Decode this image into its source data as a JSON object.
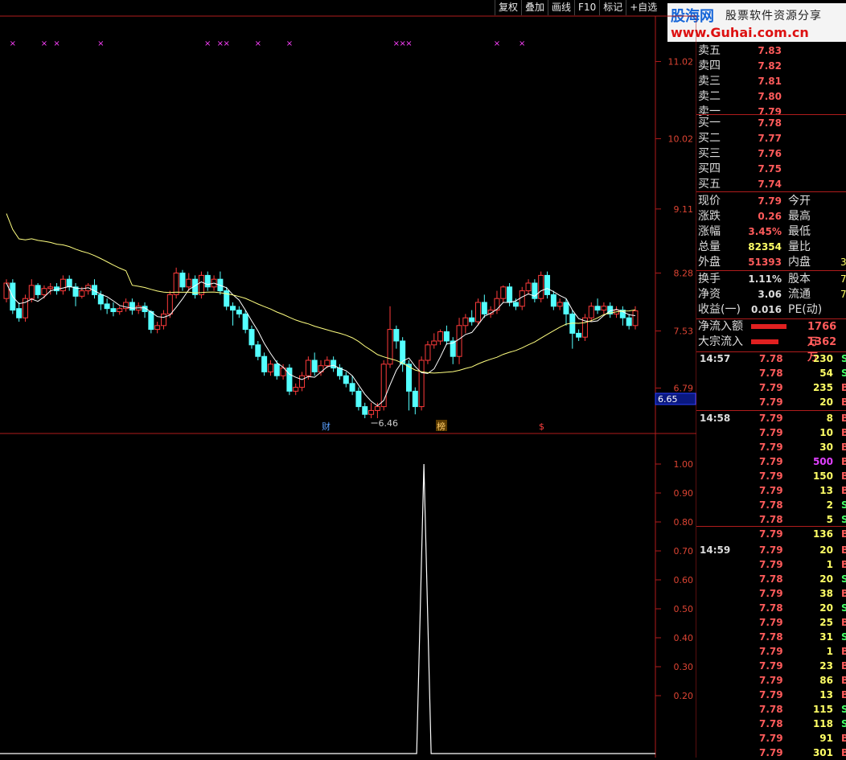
{
  "toolbar": {
    "items": [
      "复权",
      "叠加",
      "画线",
      "F10",
      "标记",
      "+自选"
    ]
  },
  "logo": {
    "brand": "股海网",
    "slogan": "股票软件资源分享",
    "url": "www.Guhai.com.cn"
  },
  "price_axis": {
    "labels": [
      "11.02",
      "10.02",
      "9.11",
      "8.28",
      "7.53",
      "6.79"
    ],
    "current": "6.65"
  },
  "indicator_axis": {
    "labels": [
      "1.00",
      "0.90",
      "0.80",
      "0.70",
      "0.60",
      "0.50",
      "0.40",
      "0.30",
      "0.20"
    ]
  },
  "chart_markers": {
    "low_label": "6.46",
    "cai": "财",
    "bang": "榜",
    "dollar": "$"
  },
  "colors": {
    "up": "#ff3b3b",
    "down": "#54ffff",
    "ma_fast": "#ffffff",
    "ma_slow": "#ffff80",
    "frame": "#b01c1c",
    "marker": "#ff40ff"
  },
  "order_book": {
    "sells": [
      {
        "label": "卖五",
        "price": "7.83"
      },
      {
        "label": "卖四",
        "price": "7.82"
      },
      {
        "label": "卖三",
        "price": "7.81"
      },
      {
        "label": "卖二",
        "price": "7.80"
      },
      {
        "label": "卖一",
        "price": "7.79"
      }
    ],
    "buys": [
      {
        "label": "买一",
        "price": "7.78"
      },
      {
        "label": "买二",
        "price": "7.77"
      },
      {
        "label": "买三",
        "price": "7.76"
      },
      {
        "label": "买四",
        "price": "7.75"
      },
      {
        "label": "买五",
        "price": "7.74"
      }
    ]
  },
  "quote": [
    {
      "k": "现价",
      "v": "7.79",
      "vc": "#ff5b5b",
      "k2": "今开",
      "v2": ""
    },
    {
      "k": "涨跌",
      "v": "0.26",
      "vc": "#ff5b5b",
      "k2": "最高",
      "v2": ""
    },
    {
      "k": "涨幅",
      "v": "3.45%",
      "vc": "#ff5b5b",
      "k2": "最低",
      "v2": ""
    },
    {
      "k": "总量",
      "v": "82354",
      "vc": "#ffff66",
      "k2": "量比",
      "v2": ""
    },
    {
      "k": "外盘",
      "v": "51393",
      "vc": "#ff5b5b",
      "k2": "内盘",
      "v2": "3"
    }
  ],
  "quote2": [
    {
      "k": "换手",
      "v": "1.11%",
      "vc": "#ddd",
      "k2": "股本",
      "v2": "7"
    },
    {
      "k": "净资",
      "v": "3.06",
      "vc": "#ddd",
      "k2": "流通",
      "v2": "7"
    },
    {
      "k": "收益(一)",
      "v": "0.016",
      "vc": "#ddd",
      "k2": "PE(动)",
      "v2": ""
    }
  ],
  "flows": [
    {
      "k": "净流入额",
      "v": "1766万",
      "bar": 1.0
    },
    {
      "k": "大宗流入",
      "v": "1362万",
      "bar": 0.77
    }
  ],
  "ticks": [
    {
      "t": "14:57",
      "p": "7.78",
      "v": "230",
      "f": "S"
    },
    {
      "t": "",
      "p": "7.78",
      "v": "54",
      "f": "S"
    },
    {
      "t": "",
      "p": "7.79",
      "v": "235",
      "f": "B"
    },
    {
      "t": "",
      "p": "7.79",
      "v": "20",
      "f": "B"
    },
    {
      "t": "14:58",
      "p": "7.79",
      "v": "8",
      "f": "B"
    },
    {
      "t": "",
      "p": "7.79",
      "v": "10",
      "f": "B"
    },
    {
      "t": "",
      "p": "7.79",
      "v": "30",
      "f": "B"
    },
    {
      "t": "",
      "p": "7.79",
      "v": "500",
      "f": "B"
    },
    {
      "t": "",
      "p": "7.79",
      "v": "150",
      "f": "B"
    },
    {
      "t": "",
      "p": "7.79",
      "v": "13",
      "f": "B"
    },
    {
      "t": "",
      "p": "7.78",
      "v": "2",
      "f": "S"
    },
    {
      "t": "",
      "p": "7.78",
      "v": "5",
      "f": "S"
    },
    {
      "t": "",
      "p": "7.79",
      "v": "136",
      "f": "B"
    },
    {
      "t": "14:59",
      "p": "7.79",
      "v": "20",
      "f": "B"
    },
    {
      "t": "",
      "p": "7.79",
      "v": "1",
      "f": "B"
    },
    {
      "t": "",
      "p": "7.78",
      "v": "20",
      "f": "S"
    },
    {
      "t": "",
      "p": "7.79",
      "v": "38",
      "f": "B"
    },
    {
      "t": "",
      "p": "7.78",
      "v": "20",
      "f": "S"
    },
    {
      "t": "",
      "p": "7.79",
      "v": "25",
      "f": "B"
    },
    {
      "t": "",
      "p": "7.78",
      "v": "31",
      "f": "S"
    },
    {
      "t": "",
      "p": "7.79",
      "v": "1",
      "f": "B"
    },
    {
      "t": "",
      "p": "7.79",
      "v": "23",
      "f": "B"
    },
    {
      "t": "",
      "p": "7.79",
      "v": "86",
      "f": "B"
    },
    {
      "t": "",
      "p": "7.79",
      "v": "13",
      "f": "B"
    },
    {
      "t": "",
      "p": "7.78",
      "v": "115",
      "f": "S"
    },
    {
      "t": "",
      "p": "7.78",
      "v": "118",
      "f": "S"
    },
    {
      "t": "",
      "p": "7.79",
      "v": "91",
      "f": "B"
    },
    {
      "t": "",
      "p": "7.79",
      "v": "301",
      "f": "B"
    }
  ],
  "chart_data": {
    "type": "candlestick",
    "y_range": [
      6.4,
      11.4
    ],
    "candles": [
      [
        7.95,
        8.15,
        7.9,
        8.2
      ],
      [
        8.15,
        7.8,
        7.75,
        8.2
      ],
      [
        7.82,
        7.7,
        7.65,
        7.9
      ],
      [
        7.7,
        7.95,
        7.65,
        8.0
      ],
      [
        7.95,
        8.12,
        7.9,
        8.2
      ],
      [
        8.12,
        8.0,
        7.95,
        8.15
      ],
      [
        8.0,
        8.08,
        7.95,
        8.12
      ],
      [
        8.08,
        8.1,
        8.0,
        8.15
      ],
      [
        8.1,
        8.05,
        8.0,
        8.15
      ],
      [
        8.05,
        8.2,
        8.0,
        8.25
      ],
      [
        8.2,
        8.1,
        8.05,
        8.25
      ],
      [
        8.1,
        7.98,
        7.85,
        8.15
      ],
      [
        7.98,
        8.05,
        7.95,
        8.1
      ],
      [
        8.05,
        8.12,
        8.0,
        8.15
      ],
      [
        8.12,
        8.0,
        7.95,
        8.2
      ],
      [
        8.0,
        7.88,
        7.8,
        8.05
      ],
      [
        7.88,
        7.82,
        7.75,
        7.95
      ],
      [
        7.82,
        7.78,
        7.72,
        7.9
      ],
      [
        7.78,
        7.82,
        7.74,
        7.85
      ],
      [
        7.82,
        7.9,
        7.78,
        7.95
      ],
      [
        7.9,
        7.8,
        7.74,
        7.95
      ],
      [
        7.8,
        7.85,
        7.75,
        7.9
      ],
      [
        7.85,
        7.78,
        7.7,
        7.9
      ],
      [
        7.78,
        7.55,
        7.5,
        7.8
      ],
      [
        7.55,
        7.6,
        7.5,
        7.65
      ],
      [
        7.6,
        7.75,
        7.55,
        7.8
      ],
      [
        7.75,
        8.0,
        7.7,
        8.05
      ],
      [
        8.0,
        8.28,
        7.95,
        8.35
      ],
      [
        8.28,
        8.1,
        8.05,
        8.32
      ],
      [
        8.1,
        8.2,
        8.05,
        8.28
      ],
      [
        8.2,
        8.0,
        7.95,
        8.25
      ],
      [
        8.0,
        8.25,
        7.95,
        8.3
      ],
      [
        8.25,
        8.1,
        8.05,
        8.3
      ],
      [
        8.1,
        8.2,
        8.05,
        8.25
      ],
      [
        8.2,
        8.05,
        8.0,
        8.3
      ],
      [
        8.05,
        7.85,
        7.8,
        8.1
      ],
      [
        7.85,
        7.8,
        7.6,
        7.9
      ],
      [
        7.8,
        7.75,
        7.7,
        7.85
      ],
      [
        7.75,
        7.55,
        7.5,
        7.8
      ],
      [
        7.55,
        7.35,
        7.3,
        7.6
      ],
      [
        7.35,
        7.2,
        7.15,
        7.4
      ],
      [
        7.2,
        7.0,
        6.95,
        7.25
      ],
      [
        7.0,
        7.1,
        6.95,
        7.15
      ],
      [
        7.1,
        6.95,
        6.9,
        7.15
      ],
      [
        6.95,
        7.05,
        6.9,
        7.1
      ],
      [
        7.05,
        6.75,
        6.7,
        7.1
      ],
      [
        6.75,
        6.8,
        6.7,
        6.85
      ],
      [
        6.8,
        6.95,
        6.75,
        7.0
      ],
      [
        6.95,
        7.15,
        6.9,
        7.2
      ],
      [
        7.15,
        7.0,
        6.95,
        7.25
      ],
      [
        7.0,
        7.08,
        6.95,
        7.15
      ],
      [
        7.08,
        7.15,
        7.05,
        7.2
      ],
      [
        7.15,
        7.05,
        7.0,
        7.2
      ],
      [
        7.05,
        6.95,
        6.9,
        7.1
      ],
      [
        6.95,
        6.85,
        6.8,
        7.0
      ],
      [
        6.85,
        6.75,
        6.7,
        6.95
      ],
      [
        6.75,
        6.55,
        6.5,
        6.8
      ],
      [
        6.55,
        6.45,
        6.4,
        6.6
      ],
      [
        6.45,
        6.5,
        6.4,
        6.6
      ],
      [
        6.5,
        6.55,
        6.4,
        6.6
      ],
      [
        6.55,
        7.1,
        6.5,
        7.15
      ],
      [
        7.1,
        7.55,
        7.05,
        7.85
      ],
      [
        7.55,
        7.4,
        7.3,
        7.6
      ],
      [
        7.4,
        7.1,
        7.0,
        7.45
      ],
      [
        7.1,
        6.75,
        6.5,
        7.15
      ],
      [
        6.75,
        6.55,
        6.45,
        6.8
      ],
      [
        6.55,
        7.15,
        6.5,
        7.2
      ],
      [
        7.15,
        7.35,
        7.1,
        7.4
      ],
      [
        7.35,
        7.4,
        7.3,
        7.5
      ],
      [
        7.4,
        7.52,
        7.35,
        7.55
      ],
      [
        7.52,
        7.4,
        7.35,
        7.6
      ],
      [
        7.4,
        7.2,
        7.1,
        7.45
      ],
      [
        7.2,
        7.6,
        7.1,
        7.7
      ],
      [
        7.6,
        7.7,
        7.5,
        7.75
      ],
      [
        7.7,
        7.65,
        7.6,
        7.8
      ],
      [
        7.65,
        7.9,
        7.6,
        7.95
      ],
      [
        7.9,
        7.75,
        7.7,
        8.0
      ],
      [
        7.75,
        7.8,
        7.7,
        7.85
      ],
      [
        7.8,
        7.95,
        7.75,
        8.05
      ],
      [
        7.95,
        8.1,
        7.9,
        8.12
      ],
      [
        8.1,
        7.9,
        7.85,
        8.15
      ],
      [
        7.9,
        7.85,
        7.8,
        7.95
      ],
      [
        7.85,
        8.05,
        7.8,
        8.1
      ],
      [
        8.05,
        8.15,
        8.0,
        8.2
      ],
      [
        8.15,
        7.95,
        7.9,
        8.2
      ],
      [
        7.95,
        8.25,
        7.9,
        8.3
      ],
      [
        8.25,
        8.0,
        7.95,
        8.3
      ],
      [
        8.0,
        7.85,
        7.8,
        8.05
      ],
      [
        7.85,
        7.9,
        7.8,
        7.95
      ],
      [
        7.9,
        7.75,
        7.6,
        7.95
      ],
      [
        7.75,
        7.5,
        7.3,
        7.8
      ],
      [
        7.5,
        7.45,
        7.4,
        7.55
      ],
      [
        7.45,
        7.7,
        7.4,
        7.75
      ],
      [
        7.7,
        7.85,
        7.65,
        7.9
      ],
      [
        7.85,
        7.8,
        7.75,
        7.95
      ],
      [
        7.8,
        7.85,
        7.75,
        7.9
      ],
      [
        7.85,
        7.75,
        7.7,
        7.9
      ],
      [
        7.75,
        7.8,
        7.7,
        7.85
      ],
      [
        7.8,
        7.7,
        7.6,
        7.85
      ],
      [
        7.7,
        7.6,
        7.55,
        7.75
      ],
      [
        7.6,
        7.79,
        7.55,
        7.85
      ]
    ],
    "indicator": {
      "range": [
        0,
        1.05
      ],
      "spike_index": 66,
      "spike_value": 1.0
    }
  }
}
